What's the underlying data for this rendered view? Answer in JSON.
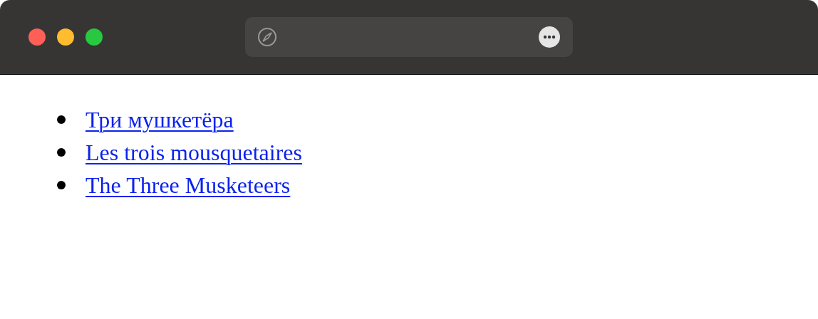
{
  "links": [
    {
      "label": "Три мушкетёра"
    },
    {
      "label": "Les trois mousquetaires"
    },
    {
      "label": "The Three Musketeers"
    }
  ]
}
